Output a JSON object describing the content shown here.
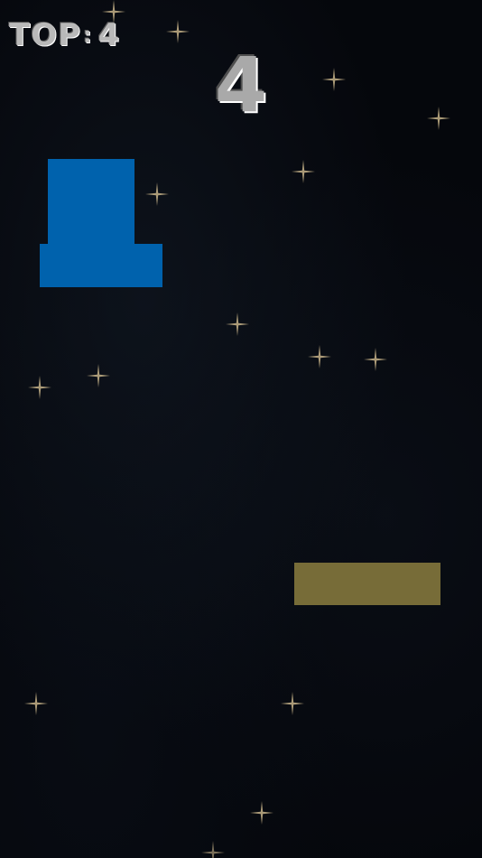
{
  "hud": {
    "top_label": "TOP",
    "top_separator": ":",
    "top_value": "4",
    "score": "4"
  },
  "colors": {
    "background": "#05070c",
    "player_block": "#0062ad",
    "platform_block": "#776c38",
    "star": "#c8b48a",
    "hud_text": "#b9b9b9"
  },
  "icons": {
    "star": "sparkle-star-icon"
  }
}
